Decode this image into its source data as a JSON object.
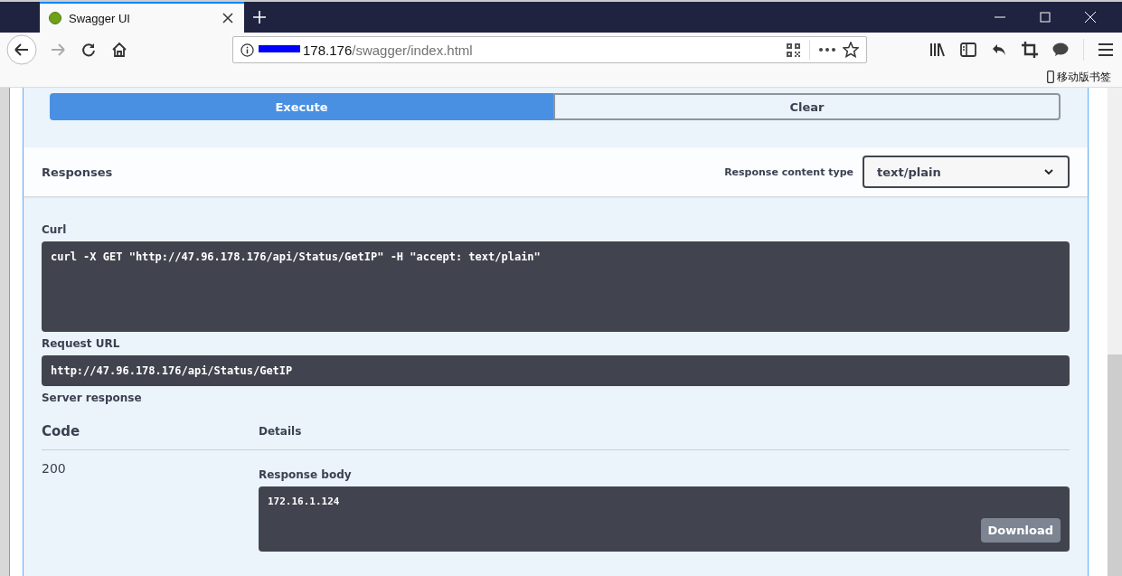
{
  "window": {
    "tab_title": "Swagger UI"
  },
  "address_bar": {
    "host": "178.176",
    "path": "/swagger/index.html"
  },
  "bookmarks_bar": {
    "mobile_bookmarks": "移动版书签"
  },
  "actions": {
    "execute": "Execute",
    "clear": "Clear"
  },
  "responses": {
    "title": "Responses",
    "content_type_label": "Response content type",
    "content_type": "text/plain"
  },
  "curl": {
    "label": "Curl",
    "command": "curl -X GET \"http://47.96.178.176/api/Status/GetIP\" -H \"accept: text/plain\""
  },
  "request_url": {
    "label": "Request URL",
    "value": "http://47.96.178.176/api/Status/GetIP"
  },
  "server_response": {
    "label": "Server response",
    "code_heading": "Code",
    "details_heading": "Details",
    "code": "200",
    "body_label": "Response body",
    "body": "172.16.1.124",
    "download": "Download"
  }
}
